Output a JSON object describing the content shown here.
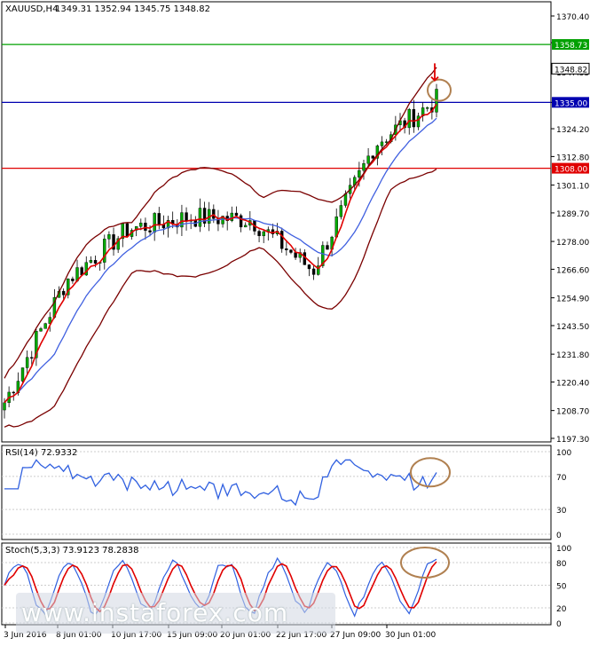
{
  "header": {
    "symbol": "XAUUSD,H4",
    "ohlc": "1349.31 1352.94 1345.75 1348.82"
  },
  "watermark": "www.instaforex.com",
  "price_axis": {
    "ticks": [
      "1370.40",
      "1359.45",
      "1347.55",
      "1335.00",
      "1324.20",
      "1312.80",
      "1301.10",
      "1289.70",
      "1278.00",
      "1266.60",
      "1254.90",
      "1243.50",
      "1231.80",
      "1220.40",
      "1208.70",
      "1197.30"
    ],
    "ymin": 1197.3,
    "ymax": 1370.4
  },
  "levels": [
    {
      "label": "1358.73",
      "value": 1358.73,
      "color": "#00a000"
    },
    {
      "label": "1348.82",
      "value": 1348.82,
      "color": "#000000",
      "kind": "current"
    },
    {
      "label": "1335.00",
      "value": 1335.0,
      "color": "#0000b0"
    },
    {
      "label": "1308.00",
      "value": 1308.0,
      "color": "#e00000"
    }
  ],
  "time_axis": [
    "3 Jun 2016",
    "8 Jun 01:00",
    "10 Jun 17:00",
    "15 Jun 09:00",
    "20 Jun 01:00",
    "22 Jun 17:00",
    "27 Jun 09:00",
    "30 Jun 01:00"
  ],
  "rsi": {
    "label": "RSI(14) 72.9332",
    "ticks": [
      "100",
      "70",
      "30",
      "0"
    ],
    "color": "#3060e0"
  },
  "stoch": {
    "label": "Stoch(5,3,3) 73.9123 78.2838",
    "ticks": [
      "100",
      "80",
      "50",
      "20",
      "0"
    ],
    "main_color": "#3060e0",
    "signal_color": "#e00000"
  },
  "colors": {
    "bull_candle": "#00aa00",
    "bear_candle": "#000000",
    "ma_fast": "#e00000",
    "ma_slow": "#4060e0",
    "envelope": "#7a0000",
    "highlight_circle": "#b08050"
  },
  "chart_data": {
    "type": "line",
    "title": "XAUUSD,H4",
    "x": [
      "3 Jun 2016",
      "8 Jun 01:00",
      "10 Jun 17:00",
      "15 Jun 09:00",
      "20 Jun 01:00",
      "22 Jun 17:00",
      "27 Jun 09:00",
      "30 Jun 01:00"
    ],
    "series": [
      {
        "name": "XAUUSD,H4",
        "values": [
          1212,
          1262,
          1283,
          1288,
          1287,
          1266,
          1318,
          1336
        ]
      }
    ],
    "ylim": [
      1197.3,
      1370.4
    ]
  }
}
